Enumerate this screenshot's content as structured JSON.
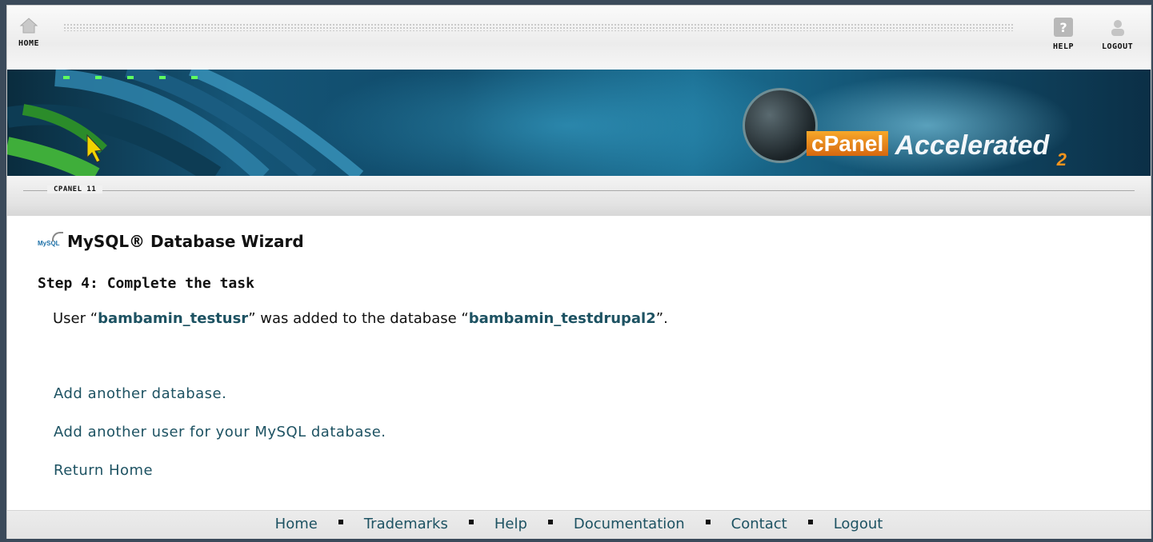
{
  "topnav": {
    "home_label": "HOME",
    "help_label": "HELP",
    "logout_label": "LOGOUT"
  },
  "banner": {
    "logo_name": "cPanel",
    "logo_tagline": "Accelerated",
    "logo_suffix": "2"
  },
  "section": {
    "tag": "CPANEL 11"
  },
  "main": {
    "title": "MySQL® Database Wizard",
    "icon_text": "MySQL",
    "step": "Step 4: Complete the task",
    "message": {
      "prefix": "User “",
      "user": "bambamin_testusr",
      "middle": "” was added to the database “",
      "database": "bambamin_testdrupal2",
      "suffix": "”."
    },
    "links": [
      "Add another database.",
      "Add another user for your MySQL database.",
      "Return Home"
    ]
  },
  "footer": {
    "links": [
      "Home",
      "Trademarks",
      "Help",
      "Documentation",
      "Contact",
      "Logout"
    ]
  },
  "colors": {
    "link": "#1d5262",
    "frame": "#3b4a5a",
    "banner": "#155577"
  }
}
